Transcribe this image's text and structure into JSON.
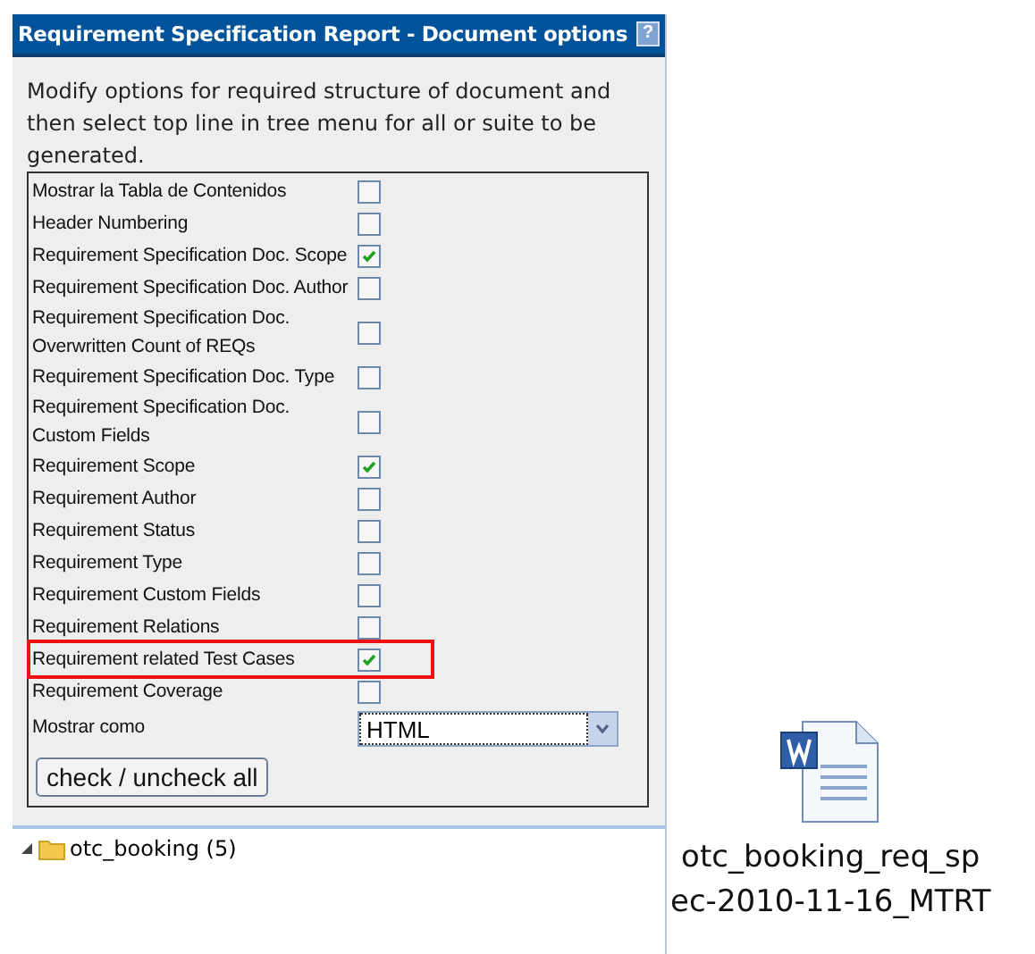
{
  "panel": {
    "title": "Requirement Specification Report - Document options",
    "help_icon": "?",
    "intro": "Modify options for required structure of document and then select top line in tree menu for all or suite to be generated.",
    "options": [
      {
        "label": "Mostrar la Tabla de Contenidos",
        "checked": false,
        "highlighted": false
      },
      {
        "label": "Header Numbering",
        "checked": false,
        "highlighted": false
      },
      {
        "label": "Requirement Specification Doc. Scope",
        "checked": true,
        "highlighted": false
      },
      {
        "label": "Requirement Specification Doc. Author",
        "checked": false,
        "highlighted": false
      },
      {
        "label": "Requirement Specification Doc. Overwritten Count of REQs",
        "checked": false,
        "highlighted": false
      },
      {
        "label": "Requirement Specification Doc. Type",
        "checked": false,
        "highlighted": false
      },
      {
        "label": "Requirement Specification Doc. Custom Fields",
        "checked": false,
        "highlighted": false
      },
      {
        "label": "Requirement Scope",
        "checked": true,
        "highlighted": false
      },
      {
        "label": "Requirement Author",
        "checked": false,
        "highlighted": false
      },
      {
        "label": "Requirement Status",
        "checked": false,
        "highlighted": false
      },
      {
        "label": "Requirement Type",
        "checked": false,
        "highlighted": false
      },
      {
        "label": "Requirement Custom Fields",
        "checked": false,
        "highlighted": false
      },
      {
        "label": "Requirement Relations",
        "checked": false,
        "highlighted": false
      },
      {
        "label": "Requirement related Test Cases",
        "checked": true,
        "highlighted": true
      },
      {
        "label": "Requirement Coverage",
        "checked": false,
        "highlighted": false
      }
    ],
    "format": {
      "label": "Mostrar como",
      "value": "HTML"
    },
    "toggle_button": "check / uncheck all",
    "tree": [
      {
        "label": "otc_booking (5)",
        "expanded": true
      }
    ]
  },
  "file": {
    "name_lines": [
      "otc_booking_req_sp",
      "ec-2010-11-16_MTRT"
    ]
  }
}
